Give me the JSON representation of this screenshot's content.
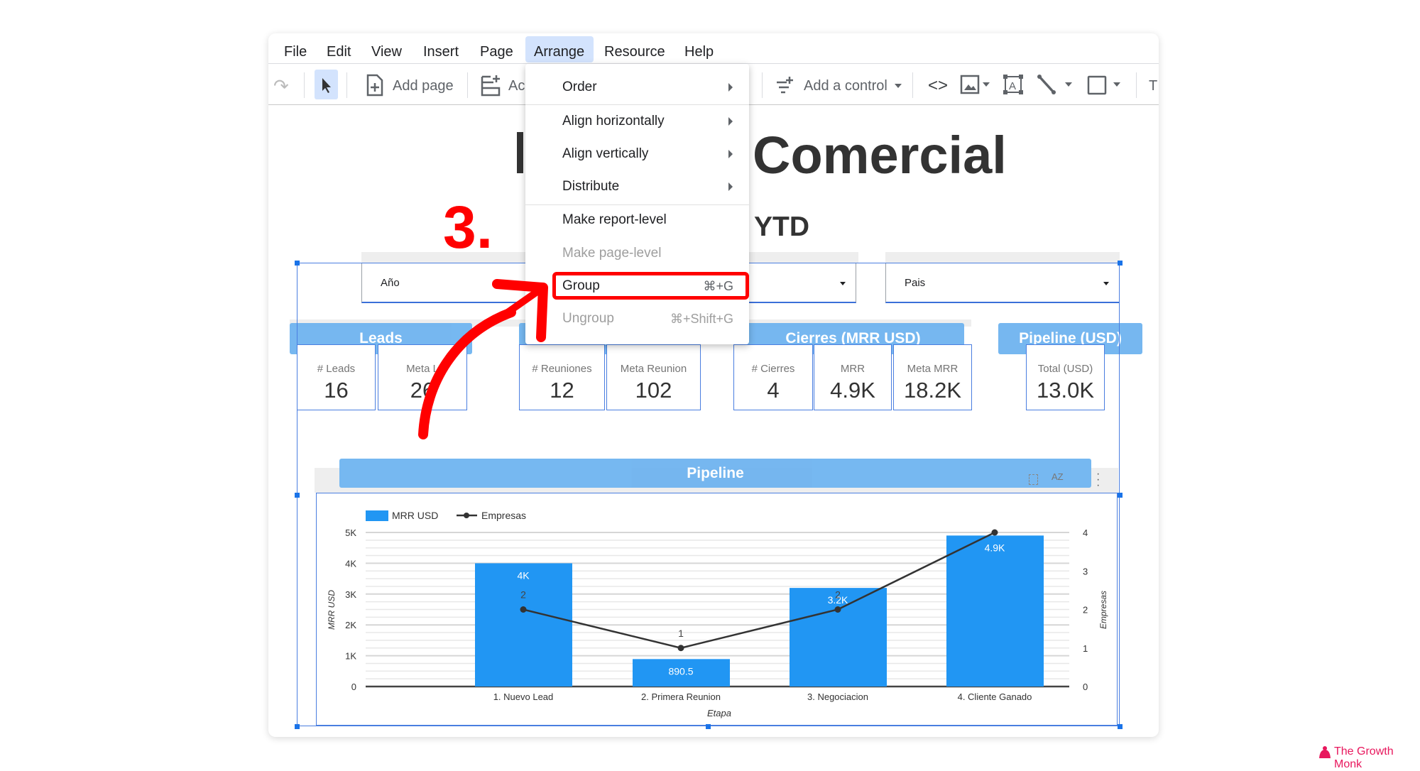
{
  "menubar": {
    "items": [
      "File",
      "Edit",
      "View",
      "Insert",
      "Page",
      "Arrange",
      "Resource",
      "Help"
    ],
    "active": "Arrange"
  },
  "toolbar": {
    "add_page": "Add page",
    "add_partial": "Ac",
    "add_control": "Add a control",
    "text_partial": "T"
  },
  "arrange_menu": {
    "items": [
      {
        "label": "Order",
        "submenu": true,
        "enabled": true
      },
      {
        "label": "Align horizontally",
        "submenu": true,
        "enabled": true
      },
      {
        "label": "Align vertically",
        "submenu": true,
        "enabled": true
      },
      {
        "label": "Distribute",
        "submenu": true,
        "enabled": true
      },
      {
        "label": "Make report-level",
        "enabled": true
      },
      {
        "label": "Make page-level",
        "enabled": false
      },
      {
        "label": "Group",
        "shortcut": "⌘+G",
        "enabled": true,
        "highlighted": true
      },
      {
        "label": "Ungroup",
        "shortcut": "⌘+Shift+G",
        "enabled": false
      }
    ]
  },
  "annotation": {
    "step": "3.",
    "color": "#ff0000"
  },
  "report": {
    "title": "Comercial",
    "subtitle": "YTD",
    "filters": [
      {
        "label": "Año"
      },
      {
        "label": ""
      },
      {
        "label": "Pais"
      }
    ],
    "scorecards": [
      {
        "header": "Leads",
        "cards": [
          {
            "label": "# Leads",
            "value": "16"
          },
          {
            "label": "Meta L",
            "value": "26"
          }
        ]
      },
      {
        "header": "",
        "cards": [
          {
            "label": "# Reuniones",
            "value": "12"
          },
          {
            "label": "Meta Reunion",
            "value": "102"
          }
        ]
      },
      {
        "header": "Cierres (MRR USD)",
        "cards": [
          {
            "label": "# Cierres",
            "value": "4"
          },
          {
            "label": "MRR",
            "value": "4.9K"
          },
          {
            "label": "Meta MRR",
            "value": "18.2K"
          }
        ]
      },
      {
        "header": "Pipeline (USD)",
        "cards": [
          {
            "label": "Total (USD)",
            "value": "13.0K"
          }
        ]
      }
    ],
    "chart_header": "Pipeline"
  },
  "chart_data": {
    "type": "bar",
    "categories": [
      "1. Nuevo Lead",
      "2. Primera Reunion",
      "3. Negociacion",
      "4. Cliente Ganado"
    ],
    "series": [
      {
        "name": "MRR USD",
        "type": "bar",
        "axis": "left",
        "values": [
          4000,
          890.5,
          3200,
          4900
        ],
        "labels": [
          "4K",
          "890.5",
          "3.2K",
          "4.9K"
        ],
        "color": "#2196f3"
      },
      {
        "name": "Empresas",
        "type": "line",
        "axis": "right",
        "values": [
          2,
          1,
          2,
          4
        ],
        "labels": [
          "2",
          "1",
          "2",
          "4"
        ],
        "color": "#333333"
      }
    ],
    "xlabel": "Etapa",
    "ylabel": "MRR USD",
    "y2label": "Empresas",
    "ylim": [
      0,
      5000
    ],
    "y2lim": [
      0,
      4
    ],
    "yticks": [
      "0",
      "1K",
      "2K",
      "3K",
      "4K",
      "5K"
    ],
    "y2ticks": [
      "0",
      "1",
      "2",
      "3",
      "4"
    ],
    "legend": "top-left",
    "grid": true
  },
  "watermark": "The Growth Monk",
  "colors": {
    "accent": "#1a73e8",
    "menu_active": "#d3e3fd",
    "header_blue": "#6fb4f0",
    "brand": "#e8175d"
  }
}
